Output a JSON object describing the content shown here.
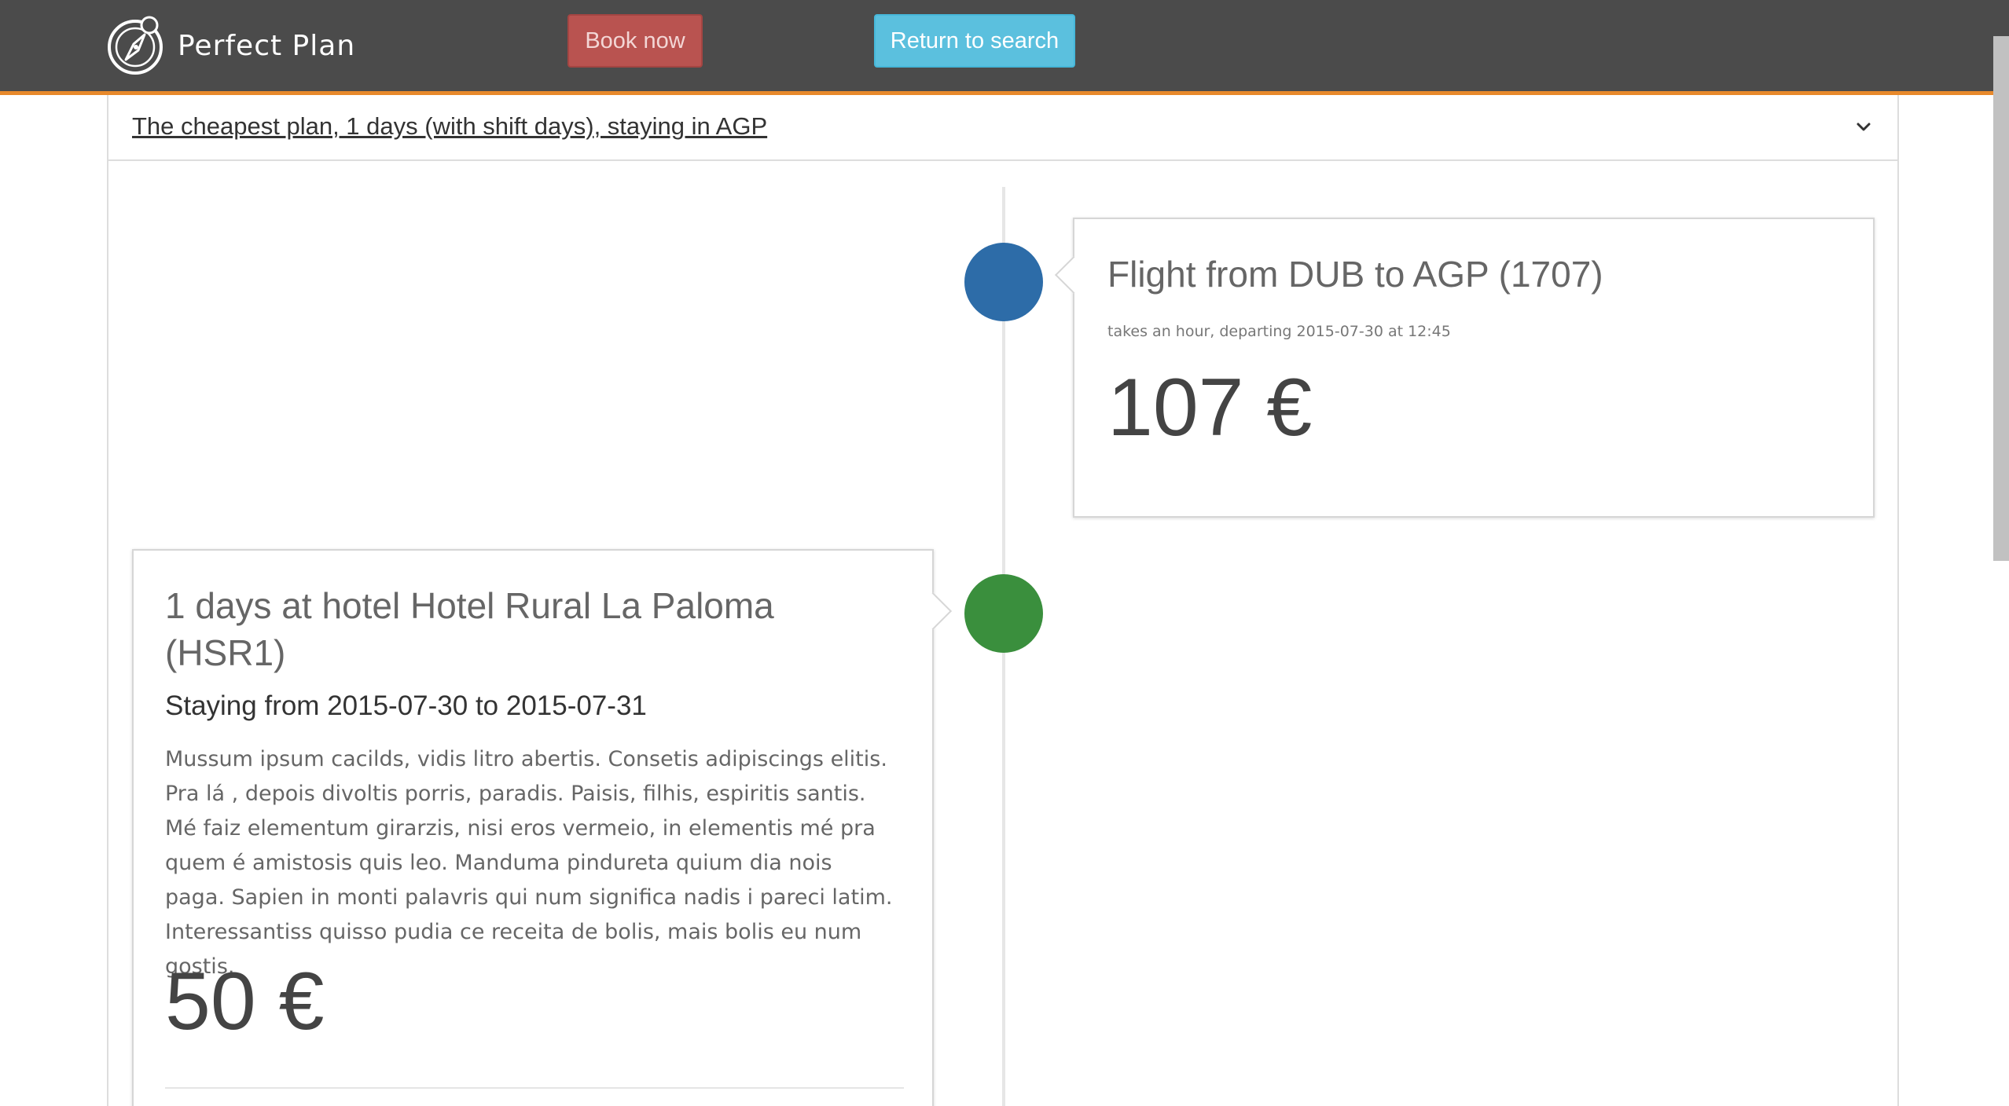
{
  "header": {
    "brand_name": "Perfect Plan",
    "logo_icon": "compass-icon",
    "book_label": "Book now",
    "return_label": "Return to search",
    "accent_color": "#e8892b",
    "book_color": "#b95350",
    "return_color": "#5bc0de"
  },
  "plan": {
    "title": "The cheapest plan, 1 days (with shift days), staying in AGP",
    "toggle_icon": "chevron-down-icon"
  },
  "timeline": {
    "flight": {
      "title": "Flight from DUB to AGP (1707)",
      "subtitle": "takes an hour, departing 2015-07-30 at 12:45",
      "price": "107 €",
      "dot_color": "#2d6ca8"
    },
    "hotel": {
      "title": "1 days at hotel Hotel Rural La Paloma (HSR1)",
      "stay": "Staying from 2015-07-30 to 2015-07-31",
      "description": "Mussum ipsum cacilds, vidis litro abertis. Consetis adipiscings elitis. Pra lá , depois divoltis porris, paradis. Paisis, filhis, espiritis santis. Mé faiz elementum girarzis, nisi eros vermeio, in elementis mé pra quem é amistosis quis leo. Manduma pindureta quium dia nois paga. Sapien in monti palavris qui num significa nadis i pareci latim. Interessantiss quisso pudia ce receita de bolis, mais bolis eu num gostis.",
      "price": "50 €",
      "dot_color": "#3a8f3d"
    }
  }
}
